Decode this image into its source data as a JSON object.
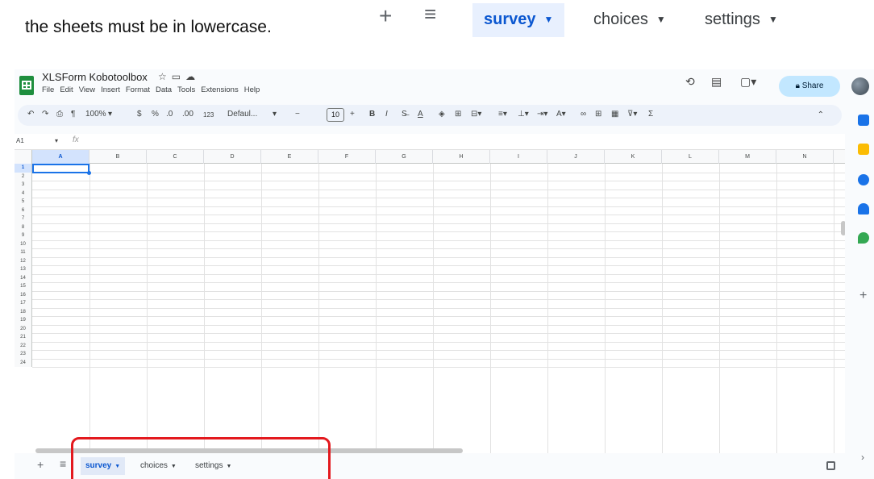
{
  "instruction": "the sheets must be in lowercase.",
  "zoomed_tabs": {
    "add_icon": "plus-icon",
    "menu_icon": "menu-icon",
    "tabs": [
      {
        "label": "survey",
        "active": true
      },
      {
        "label": "choices",
        "active": false
      },
      {
        "label": "settings",
        "active": false
      }
    ]
  },
  "app": {
    "title": "XLSForm Kobotoolbox",
    "menu": [
      "File",
      "Edit",
      "View",
      "Insert",
      "Format",
      "Data",
      "Tools",
      "Extensions",
      "Help"
    ],
    "share_label": "Share",
    "brand_color": "#1e8e3e",
    "accent_color": "#0b57d0",
    "share_color": "#c2e7ff"
  },
  "toolbar": {
    "zoom": "100%",
    "currency": "$",
    "percent": "%",
    "decrease_decimal": ".0",
    "increase_decimal": ".00",
    "number_format": "123",
    "font_family": "Defaul...",
    "font_size": "10",
    "bold": "B",
    "italic": "I"
  },
  "formula_bar": {
    "cell_ref": "A1",
    "fx": "fx"
  },
  "grid": {
    "columns": [
      "A",
      "B",
      "C",
      "D",
      "E",
      "F",
      "G",
      "H",
      "I",
      "J",
      "K",
      "L",
      "M",
      "N"
    ],
    "rows": [
      "1",
      "2",
      "3",
      "4",
      "5",
      "6",
      "7",
      "8",
      "9",
      "10",
      "11",
      "12",
      "13",
      "14",
      "15",
      "16",
      "17",
      "18",
      "19",
      "20",
      "21",
      "22",
      "23",
      "24"
    ],
    "selected_cell": "A1"
  },
  "sheet_tabs": [
    {
      "label": "survey",
      "active": true
    },
    {
      "label": "choices",
      "active": false
    },
    {
      "label": "settings",
      "active": false
    }
  ],
  "highlight_color": "#e3191e"
}
